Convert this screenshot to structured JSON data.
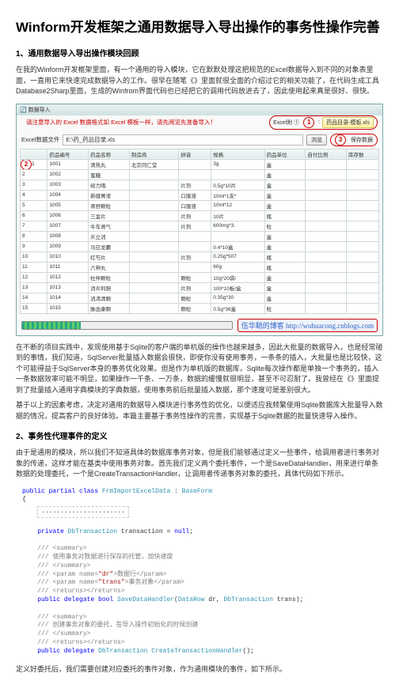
{
  "title": "Winform开发框架之通用数据导入导出操作的事务性操作完善",
  "section1": {
    "heading": "1、通用数据导入导出操作模块回顾",
    "p1": "在我的Winform开发框架里面，有一个通用的导入模块，它在默默处理这把规范的Excel数据导入到不同的对象表里面，一直用它来快速完成数据导入的工作。很早在随笔《》里面就很全面的介绍过它的相关功能了，在代码生成工具Database2Sharp里面，生成的Winfrom界面代码也已经把它的调用代码放进去了，因此使用起来真是很好、很快。"
  },
  "screenshot": {
    "winTitle": "数据导入",
    "noteLine": "请注意导入的 Excel 数据格式如 Excel 模板一样，请先阅览先准备导入！",
    "labExcel": "Excel附 ①",
    "circle1": "1",
    "excelAttach": "药品目录-模板.xls",
    "labFile": "Excel数据文件",
    "fileValue": "E:\\药_药品目录.xls",
    "btnBrowse": "浏览",
    "circle3": "3",
    "btnSave": "保存数据",
    "circle2": "2",
    "columns": [
      "",
      "药品编号",
      "药品名称",
      "制造商",
      "拼音",
      "规格",
      "药品单位",
      "自付比例",
      "库存数"
    ],
    "rows": [
      [
        "1",
        "1001",
        "清热丸",
        "北京同仁堂",
        "",
        "3g",
        "盒",
        "",
        ""
      ],
      [
        "2",
        "1002",
        "蜜糖",
        "",
        "",
        "",
        "盒",
        "",
        ""
      ],
      [
        "3",
        "1003",
        "给力哦",
        "",
        "片剂",
        "0.5g*10片",
        "盒",
        "",
        ""
      ],
      [
        "4",
        "1004",
        "新健胃液",
        "",
        "口服液",
        "10ml*1支*",
        "盒",
        "",
        ""
      ],
      [
        "5",
        "1005",
        "肾舒颗粒",
        "",
        "口服液",
        "10ml*12",
        "盒",
        "",
        ""
      ],
      [
        "6",
        "1006",
        "三金片",
        "",
        "片剂",
        "10片",
        "瓶",
        "",
        ""
      ],
      [
        "7",
        "1007",
        "牛车肾气",
        "",
        "片剂",
        "600mg*3.",
        "粒",
        "",
        ""
      ],
      [
        "8",
        "1008",
        "炎立消",
        "",
        "",
        "",
        "盒",
        "",
        ""
      ],
      [
        "9",
        "1009",
        "马应龙麝",
        "",
        "",
        "0.4*10盒",
        "盒",
        "",
        ""
      ],
      [
        "10",
        "1010",
        "红芍片",
        "",
        "片剂",
        "0.25g*507",
        "瓶",
        "",
        ""
      ],
      [
        "11",
        "1011",
        "六神丸",
        "",
        "",
        "60g",
        "瓶",
        "",
        ""
      ],
      [
        "12",
        "1012",
        "杜仲颗粒",
        "",
        "颗粒",
        "10g*20袋/",
        "盒",
        "",
        ""
      ],
      [
        "13",
        "1013",
        "消炎利胆",
        "",
        "片剂",
        "100*10板/盒",
        "盒",
        "",
        ""
      ],
      [
        "14",
        "1014",
        "消渴清颗",
        "",
        "颗粒",
        "0.35g*30",
        "盒",
        "",
        ""
      ],
      [
        "15",
        "1015",
        "脉血康颗",
        "",
        "颗粒",
        "0.5g*36盒",
        "粒",
        "",
        ""
      ]
    ],
    "watermark": "伍华聪的博客",
    "watermark_url": "http://wuhuacong.cnblogs.com"
  },
  "afterScreenshot": {
    "p2": "在不断的项目实践中，发现使用基于Sqlite的客户端的单机版的操作也越来越多，因此大批量的数据导入，也是经常碰到的事情，我们知道，SqlServer批量插入数据会很快，即使你没有使用事务，一条条的插入，大批量也是比较快，这个可能得益于SqlServer本身的事务优化效果。但是作为单机版的数据库，Sqlite每次操作都是单独一个事务的，插入一条数据效率可能不明显，如果操作一千条、一万条，数据的缓慢就很明显，甚至不可忍耐了。我曾经在《》里面提到了批量插入通用字典模块的字典数据，使用事务前后批量插入数据，那个速度可是差别很大。",
    "p3": "基于以上的因素考虑，决定对通用的数据导入模块进行事务性的优化，以便适应我频繁使用Sqlite数据库大批量导入数据的情况，提高客户的良好体验。本篇主要基于事务性操作的完善，实现基于Sqlite数据的批量快速导入操作。"
  },
  "section2": {
    "heading": "2、事务性代理事件的定义",
    "p1": "由于是通用的模块，所以我们不知道具体的数据库事务对象，但是我们能够通过定义一些事件，给调用者进行事务对象的传递，这样才能在基类中使用事务对象。首先我们定义两个委托事件，一个是SaveDataHandler，用来进行单条数据的处理委托，一个是CreateTransactionHandler，让调用者传递事务对象的委托，具体代码如下所示。"
  },
  "code": {
    "cls_line": "public partial class FrmImportExcelData : BaseForm",
    "brace_open": "{",
    "ellipsis": "......................",
    "tx_line": "private DbTransaction transaction = null;",
    "sm_open": "/// <summary>",
    "sm1": "/// 使用事务对数据进行保存的托管，加快速度",
    "sm_close": "/// </summary>",
    "pm1": "/// <param name=\"dr\">数据行</param>",
    "pm2": "/// <param name=\"trans\">事务对象</param>",
    "ret": "/// <returns></returns>",
    "del1": "public delegate bool SaveDataHandler(DataRow dr, DbTransaction trans);",
    "sm2": "/// 创建事务对象的委托，在导入操作初始化的时候创建",
    "del2": "public delegate DbTransaction CreateTransactionHandler();"
  },
  "footer_p": "定义好委托后，我们需要创建对应委托的事件对象，作为通用模块的事件，如下所示。"
}
